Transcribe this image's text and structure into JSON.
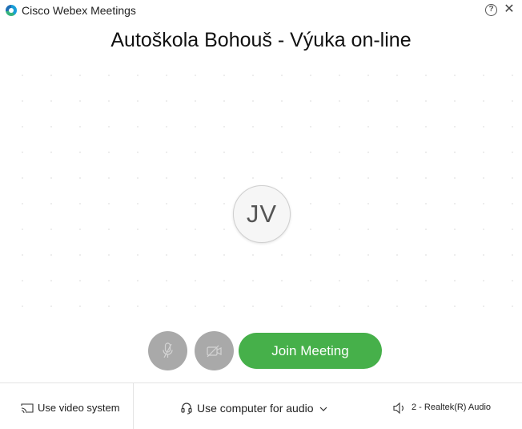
{
  "window": {
    "app_title": "Cisco Webex Meetings",
    "help_icon": "help-icon",
    "close_icon": "close-icon",
    "help_label": "?",
    "close_label": "✕"
  },
  "meeting": {
    "title": "Autoškola Bohouš - Výuka on-line",
    "avatar_initials": "JV"
  },
  "controls": {
    "mute_icon": "microphone-muted-icon",
    "video_icon": "video-off-icon",
    "join_label": "Join Meeting"
  },
  "bottom_bar": {
    "video_system_label": "Use video system",
    "audio_label": "Use computer for audio",
    "speaker_label": "2 - Realtek(R) Audio"
  },
  "colors": {
    "join_button": "#46b04a",
    "disabled_button": "#a9a9a9"
  }
}
